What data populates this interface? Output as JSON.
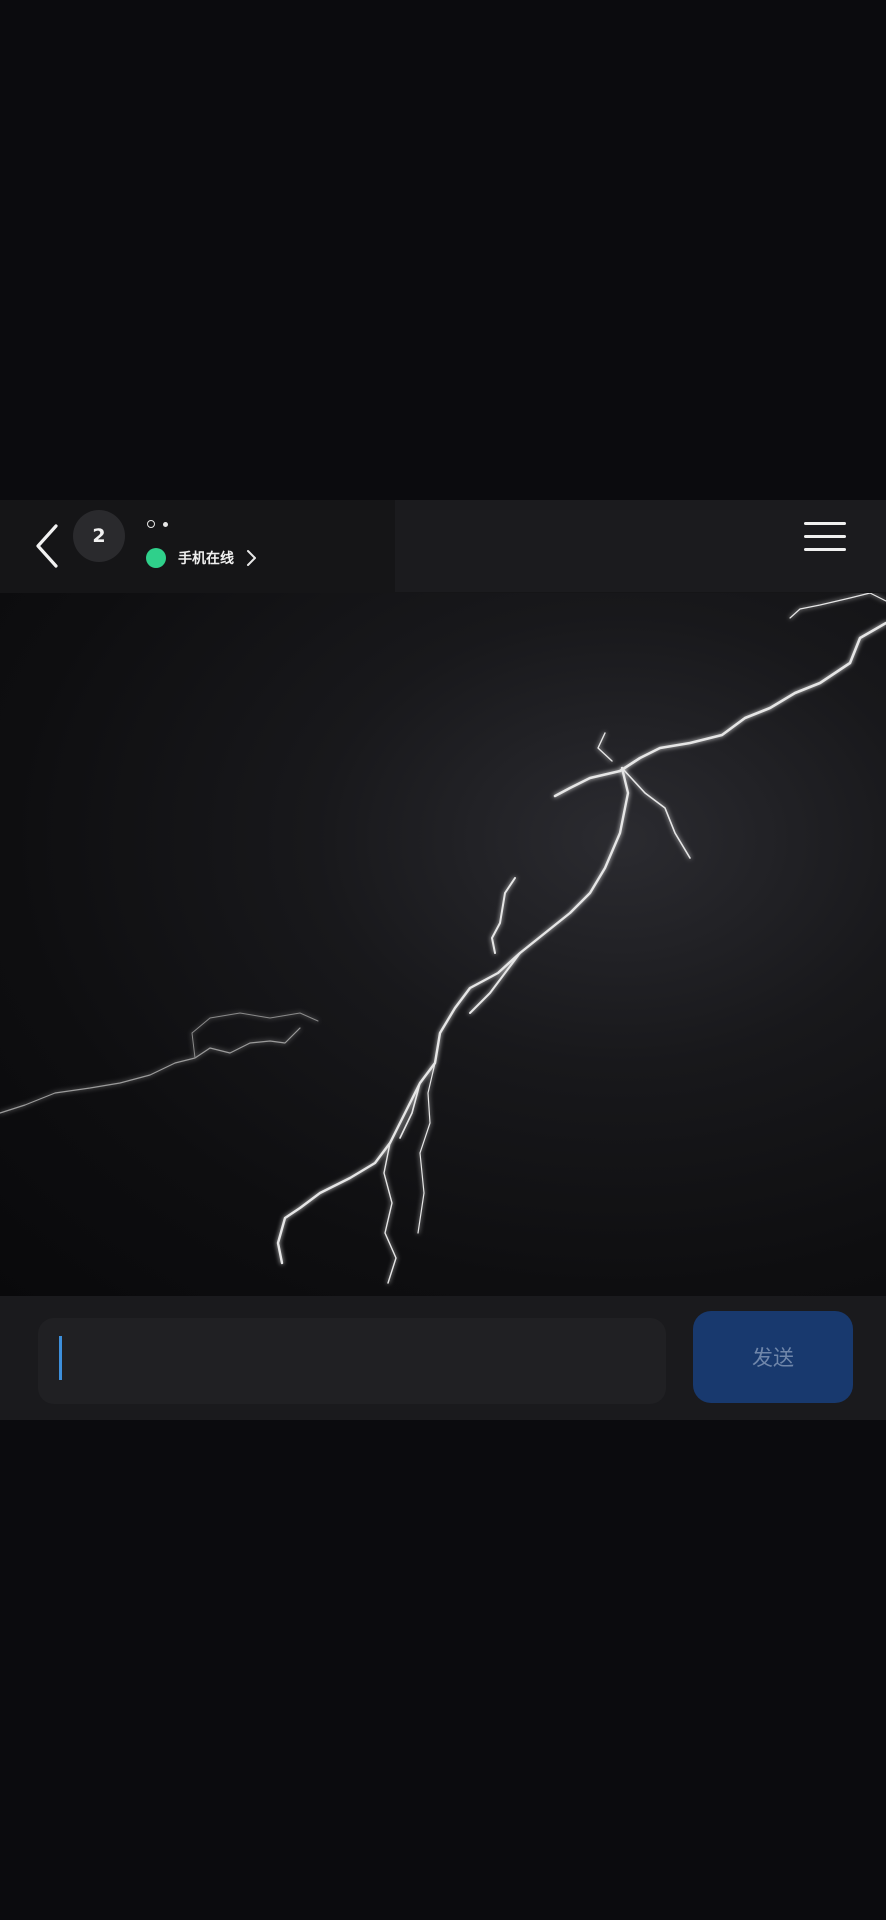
{
  "header": {
    "badge_count": "2",
    "status_text": "手机在线",
    "status_color": "#2fd08b",
    "icons": [
      "back-arrow-icon",
      "chevron-right-icon",
      "menu-icon"
    ]
  },
  "composer": {
    "input_value": "",
    "send_label": "发送",
    "send_color": "#18396e"
  }
}
